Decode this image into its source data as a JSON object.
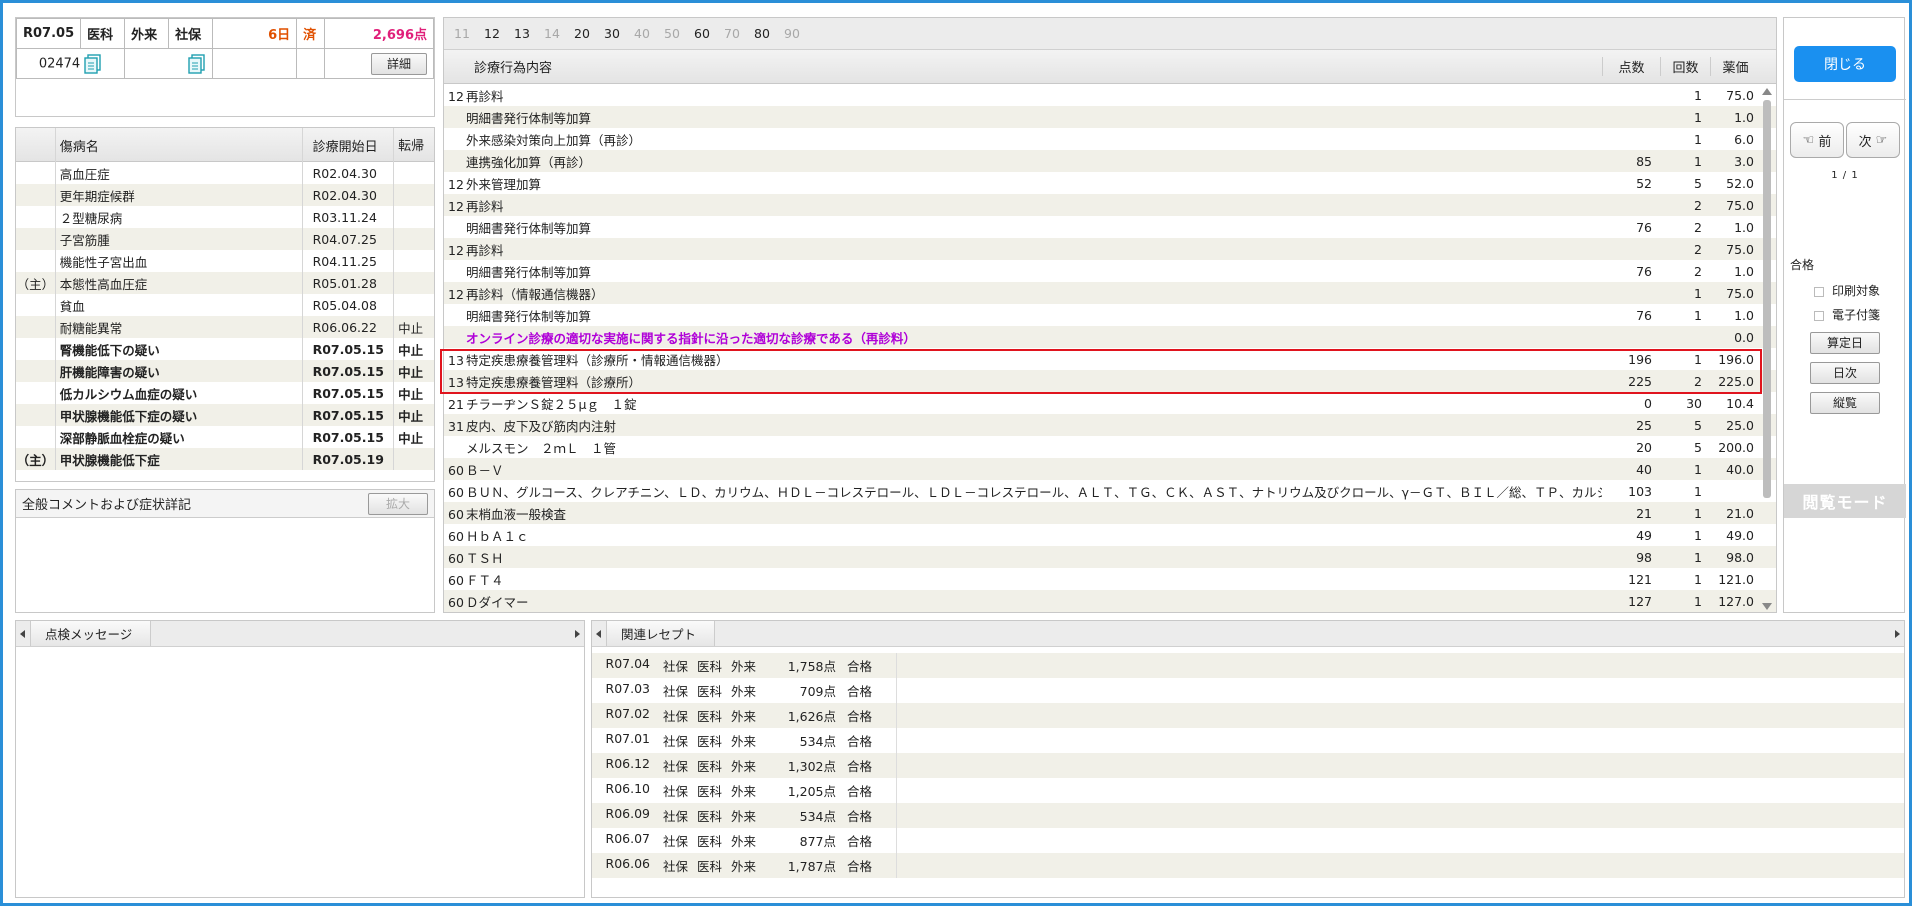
{
  "header": {
    "period": "R07.05",
    "type1": "医科",
    "type2": "外来",
    "insurer": "社保",
    "days": "6日",
    "done": "済",
    "points": "2,696点",
    "patient_id": "02474",
    "detail_button": "詳細"
  },
  "diseases": {
    "headers": [
      "",
      "傷病名",
      "診療開始日",
      "転帰"
    ],
    "rows": [
      {
        "sym": "",
        "name": "高血圧症",
        "date": "R02.04.30",
        "out": "",
        "bold": false
      },
      {
        "sym": "",
        "name": "更年期症候群",
        "date": "R02.04.30",
        "out": "",
        "bold": false
      },
      {
        "sym": "",
        "name": "２型糖尿病",
        "date": "R03.11.24",
        "out": "",
        "bold": false
      },
      {
        "sym": "",
        "name": "子宮筋腫",
        "date": "R04.07.25",
        "out": "",
        "bold": false
      },
      {
        "sym": "",
        "name": "機能性子宮出血",
        "date": "R04.11.25",
        "out": "",
        "bold": false
      },
      {
        "sym": "（主）",
        "name": "本態性高血圧症",
        "date": "R05.01.28",
        "out": "",
        "bold": false
      },
      {
        "sym": "",
        "name": "貧血",
        "date": "R05.04.08",
        "out": "",
        "bold": false
      },
      {
        "sym": "",
        "name": "耐糖能異常",
        "date": "R06.06.22",
        "out": "中止",
        "bold": false
      },
      {
        "sym": "",
        "name": "腎機能低下の疑い",
        "date": "R07.05.15",
        "out": "中止",
        "bold": true
      },
      {
        "sym": "",
        "name": "肝機能障害の疑い",
        "date": "R07.05.15",
        "out": "中止",
        "bold": true
      },
      {
        "sym": "",
        "name": "低カルシウム血症の疑い",
        "date": "R07.05.15",
        "out": "中止",
        "bold": true
      },
      {
        "sym": "",
        "name": "甲状腺機能低下症の疑い",
        "date": "R07.05.15",
        "out": "中止",
        "bold": true
      },
      {
        "sym": "",
        "name": "深部静脈血栓症の疑い",
        "date": "R07.05.15",
        "out": "中止",
        "bold": true
      },
      {
        "sym": "（主）",
        "name": "甲状腺機能低下症",
        "date": "R07.05.19",
        "out": "",
        "bold": true
      }
    ]
  },
  "comment": {
    "title": "全般コメントおよび症状詳記",
    "expand_button": "拡大"
  },
  "day_tabs": [
    {
      "label": "11",
      "active": false
    },
    {
      "label": "12",
      "active": true
    },
    {
      "label": "13",
      "active": true
    },
    {
      "label": "14",
      "active": false
    },
    {
      "label": "20",
      "active": true
    },
    {
      "label": "30",
      "active": true
    },
    {
      "label": "40",
      "active": false
    },
    {
      "label": "50",
      "active": false
    },
    {
      "label": "60",
      "active": true
    },
    {
      "label": "70",
      "active": false
    },
    {
      "label": "80",
      "active": true
    },
    {
      "label": "90",
      "active": false
    }
  ],
  "treatments": {
    "headers": [
      "診療行為内容",
      "点数",
      "回数",
      "薬価"
    ],
    "rows": [
      {
        "code": "12",
        "name": "再診料",
        "pt": "",
        "cnt": "1",
        "dr": "75.0",
        "indent": false,
        "purple": false
      },
      {
        "code": "",
        "name": "明細書発行体制等加算",
        "pt": "",
        "cnt": "1",
        "dr": "1.0",
        "indent": true,
        "purple": false
      },
      {
        "code": "",
        "name": "外来感染対策向上加算（再診）",
        "pt": "",
        "cnt": "1",
        "dr": "6.0",
        "indent": true,
        "purple": false
      },
      {
        "code": "",
        "name": "連携強化加算（再診）",
        "pt": "85",
        "cnt": "1",
        "dr": "3.0",
        "indent": true,
        "purple": false
      },
      {
        "code": "12",
        "name": "外来管理加算",
        "pt": "52",
        "cnt": "5",
        "dr": "52.0",
        "indent": false,
        "purple": false
      },
      {
        "code": "12",
        "name": "再診料",
        "pt": "",
        "cnt": "2",
        "dr": "75.0",
        "indent": false,
        "purple": false
      },
      {
        "code": "",
        "name": "明細書発行体制等加算",
        "pt": "76",
        "cnt": "2",
        "dr": "1.0",
        "indent": true,
        "purple": false
      },
      {
        "code": "12",
        "name": "再診料",
        "pt": "",
        "cnt": "2",
        "dr": "75.0",
        "indent": false,
        "purple": false
      },
      {
        "code": "",
        "name": "明細書発行体制等加算",
        "pt": "76",
        "cnt": "2",
        "dr": "1.0",
        "indent": true,
        "purple": false
      },
      {
        "code": "12",
        "name": "再診料（情報通信機器）",
        "pt": "",
        "cnt": "1",
        "dr": "75.0",
        "indent": false,
        "purple": false
      },
      {
        "code": "",
        "name": "明細書発行体制等加算",
        "pt": "76",
        "cnt": "1",
        "dr": "1.0",
        "indent": true,
        "purple": false
      },
      {
        "code": "",
        "name": "オンライン診療の適切な実施に関する指針に沿った適切な診療である（再診料）",
        "pt": "",
        "cnt": "",
        "dr": "0.0",
        "indent": true,
        "purple": true
      },
      {
        "code": "13",
        "name": "特定疾患療養管理料（診療所・情報通信機器）",
        "pt": "196",
        "cnt": "1",
        "dr": "196.0",
        "indent": false,
        "purple": false
      },
      {
        "code": "13",
        "name": "特定疾患療養管理料（診療所）",
        "pt": "225",
        "cnt": "2",
        "dr": "225.0",
        "indent": false,
        "purple": false
      },
      {
        "code": "21",
        "name": "チラーヂンＳ錠２５μｇ　１錠",
        "pt": "0",
        "cnt": "30",
        "dr": "10.4",
        "indent": false,
        "purple": false
      },
      {
        "code": "31",
        "name": "皮内、皮下及び筋肉内注射",
        "pt": "25",
        "cnt": "5",
        "dr": "25.0",
        "indent": false,
        "purple": false
      },
      {
        "code": "",
        "name": "メルスモン　２ｍＬ　１管",
        "pt": "20",
        "cnt": "5",
        "dr": "200.0",
        "indent": true,
        "purple": false
      },
      {
        "code": "60",
        "name": "Ｂ－Ｖ",
        "pt": "40",
        "cnt": "1",
        "dr": "40.0",
        "indent": false,
        "purple": false
      },
      {
        "code": "60",
        "name": "ＢＵＮ、グルコース、クレアチニン、ＬＤ、カリウム、ＨＤＬ－コレステロール、ＬＤＬ－コレステロール、ＡＬＴ、ＴＧ、ＣＫ、ＡＳＴ、ナトリウム及びクロール、γ－ＧＴ、ＢＩＬ／総、ＴＰ、カルシウム",
        "pt": "103",
        "cnt": "1",
        "dr": "",
        "indent": false,
        "purple": false
      },
      {
        "code": "60",
        "name": "末梢血液一般検査",
        "pt": "21",
        "cnt": "1",
        "dr": "21.0",
        "indent": false,
        "purple": false
      },
      {
        "code": "60",
        "name": "ＨｂＡ１ｃ",
        "pt": "49",
        "cnt": "1",
        "dr": "49.0",
        "indent": false,
        "purple": false
      },
      {
        "code": "60",
        "name": "ＴＳＨ",
        "pt": "98",
        "cnt": "1",
        "dr": "98.0",
        "indent": false,
        "purple": false
      },
      {
        "code": "60",
        "name": "ＦＴ４",
        "pt": "121",
        "cnt": "1",
        "dr": "121.0",
        "indent": false,
        "purple": false
      },
      {
        "code": "60",
        "name": "Ｄダイマー",
        "pt": "127",
        "cnt": "1",
        "dr": "127.0",
        "indent": false,
        "purple": false
      }
    ]
  },
  "side": {
    "close_button": "閉じる",
    "prev_button": "前",
    "next_button": "次",
    "page": "1 / 1",
    "status": "合格",
    "print_label": "印刷対象",
    "attach_label": "電子付箋",
    "calc_day_button": "算定日",
    "daily_button": "日次",
    "vertical_button": "縦覧",
    "browse_mode": "閲覧モード"
  },
  "check_panel": {
    "title": "点検メッセージ"
  },
  "related_panel": {
    "title": "関連レセプト",
    "rows": [
      {
        "period": "R07.04",
        "ins": "社保",
        "t1": "医科",
        "t2": "外来",
        "points": "1,758点",
        "status": "合格"
      },
      {
        "period": "R07.03",
        "ins": "社保",
        "t1": "医科",
        "t2": "外来",
        "points": "709点",
        "status": "合格"
      },
      {
        "period": "R07.02",
        "ins": "社保",
        "t1": "医科",
        "t2": "外来",
        "points": "1,626点",
        "status": "合格"
      },
      {
        "period": "R07.01",
        "ins": "社保",
        "t1": "医科",
        "t2": "外来",
        "points": "534点",
        "status": "合格"
      },
      {
        "period": "R06.12",
        "ins": "社保",
        "t1": "医科",
        "t2": "外来",
        "points": "1,302点",
        "status": "合格"
      },
      {
        "period": "R06.10",
        "ins": "社保",
        "t1": "医科",
        "t2": "外来",
        "points": "1,205点",
        "status": "合格"
      },
      {
        "period": "R06.09",
        "ins": "社保",
        "t1": "医科",
        "t2": "外来",
        "points": "534点",
        "status": "合格"
      },
      {
        "period": "R06.07",
        "ins": "社保",
        "t1": "医科",
        "t2": "外来",
        "points": "877点",
        "status": "合格"
      },
      {
        "period": "R06.06",
        "ins": "社保",
        "t1": "医科",
        "t2": "外来",
        "points": "1,787点",
        "status": "合格"
      }
    ]
  },
  "colors": {
    "accent": "#1a90f0",
    "highlight_border": "#e0141e",
    "purple_text": "#b000d8",
    "days_text": "#e05000",
    "points_text": "#e0207a"
  }
}
